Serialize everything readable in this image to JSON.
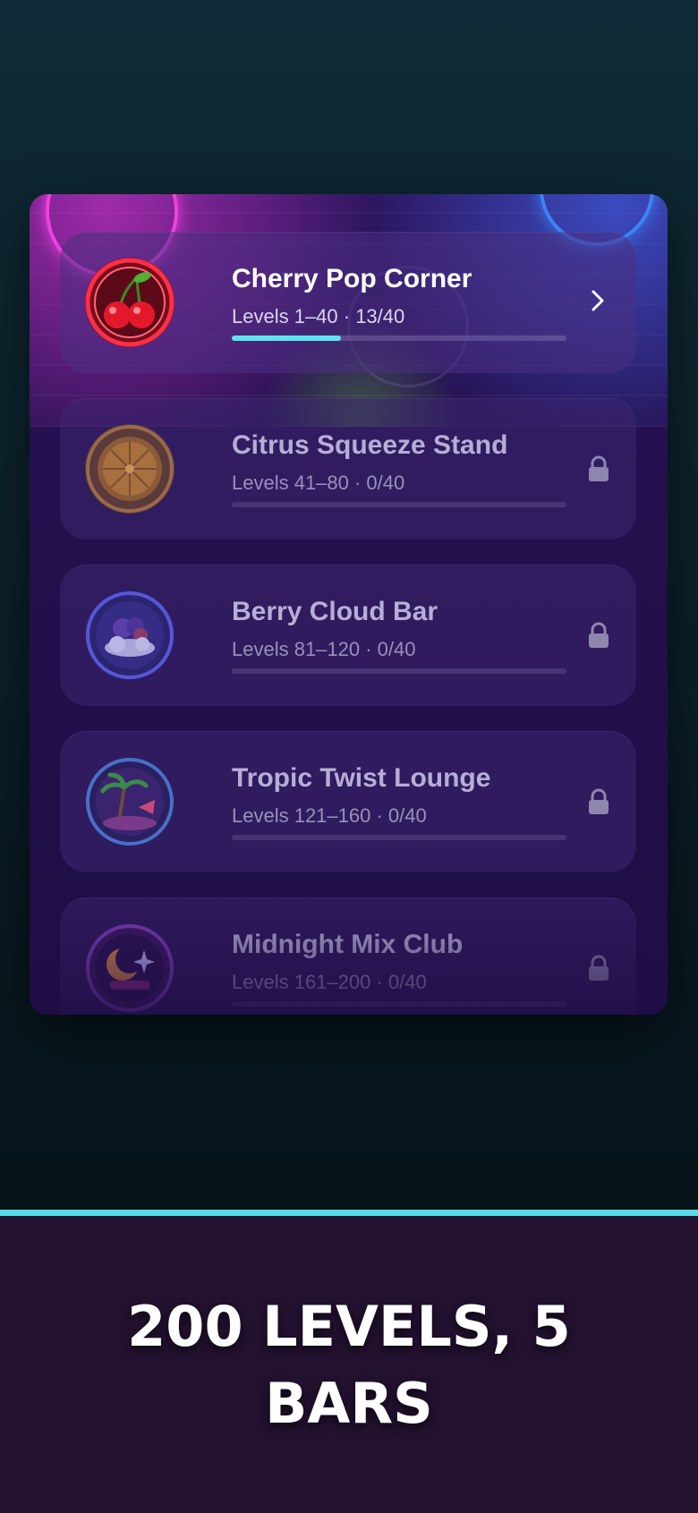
{
  "bars": [
    {
      "title": "Cherry Pop Corner",
      "levels": "Levels 1–40 · 13/40",
      "progress": 0.325,
      "status": "unlocked",
      "icon": "cherry-icon",
      "accent": "#e3262e"
    },
    {
      "title": "Citrus Squeeze Stand",
      "levels": "Levels 41–80 · 0/40",
      "progress": 0,
      "status": "locked",
      "icon": "orange-slice-icon",
      "accent": "#b07a3e"
    },
    {
      "title": "Berry Cloud Bar",
      "levels": "Levels 81–120 · 0/40",
      "progress": 0,
      "status": "locked",
      "icon": "berry-cloud-icon",
      "accent": "#5a56d8"
    },
    {
      "title": "Tropic Twist Lounge",
      "levels": "Levels 121–160 · 0/40",
      "progress": 0,
      "status": "locked",
      "icon": "palm-beach-icon",
      "accent": "#4a6fc8"
    },
    {
      "title": "Midnight Mix Club",
      "levels": "Levels 161–200 · 0/40",
      "progress": 0,
      "status": "locked",
      "icon": "moon-star-icon",
      "accent": "#7a3fb8"
    }
  ],
  "headline": "200 LEVELS, 5 BARS",
  "colors": {
    "progress": "#5fe3f0",
    "divider": "#59dbe3",
    "footer": "#22112f"
  }
}
